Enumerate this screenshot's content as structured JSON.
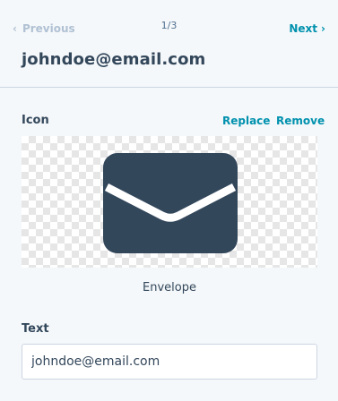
{
  "nav": {
    "previous_label": "Previous",
    "next_label": "Next",
    "pager": "1/3"
  },
  "header": {
    "title": "johndoe@email.com"
  },
  "icon_section": {
    "label": "Icon",
    "replace_label": "Replace",
    "remove_label": "Remove",
    "icon_name": "Envelope",
    "icon_semantic": "envelope-icon",
    "icon_color": "#33475b"
  },
  "text_section": {
    "label": "Text",
    "value": "johndoe@email.com"
  },
  "colors": {
    "accent": "#0091ae",
    "disabled": "#b0c1d4",
    "text": "#33475b",
    "background": "#f5f8fa"
  }
}
